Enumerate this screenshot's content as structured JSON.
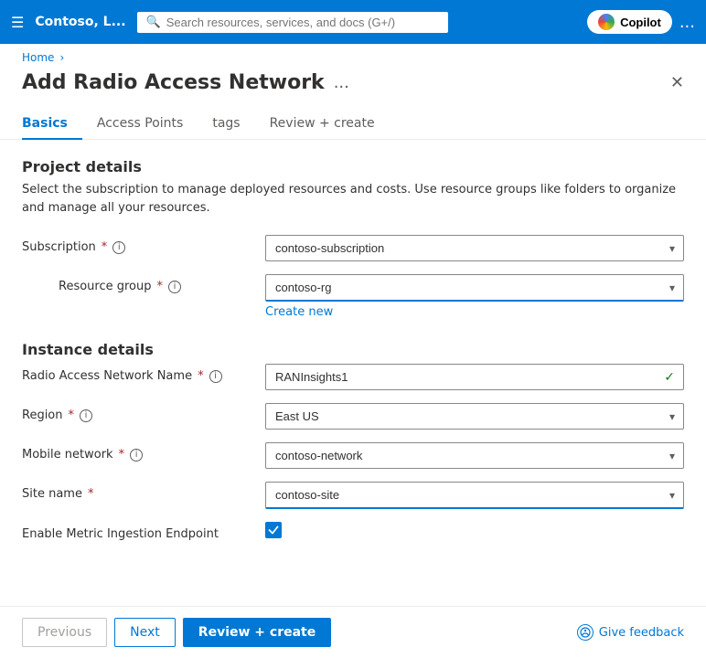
{
  "topnav": {
    "hamburger": "☰",
    "title": "Contoso, L...",
    "search_placeholder": "Search resources, services, and docs (G+/)",
    "copilot_label": "Copilot",
    "ellipsis": "..."
  },
  "breadcrumb": {
    "home": "Home",
    "separator": "›"
  },
  "page": {
    "title": "Add Radio Access Network",
    "ellipsis": "...",
    "close_label": "✕"
  },
  "tabs": [
    {
      "id": "basics",
      "label": "Basics",
      "active": true
    },
    {
      "id": "access-points",
      "label": "Access Points",
      "active": false
    },
    {
      "id": "tags",
      "label": "tags",
      "active": false
    },
    {
      "id": "review-create",
      "label": "Review + create",
      "active": false
    }
  ],
  "project_details": {
    "section_title": "Project details",
    "section_desc": "Select the subscription to manage deployed resources and costs. Use resource groups like folders to organize and manage all your resources.",
    "subscription_label": "Subscription",
    "subscription_value": "contoso-subscription",
    "resource_group_label": "Resource group",
    "resource_group_value": "contoso-rg",
    "create_new_label": "Create new"
  },
  "instance_details": {
    "section_title": "Instance details",
    "ran_name_label": "Radio Access Network Name",
    "ran_name_value": "RANInsights1",
    "region_label": "Region",
    "region_value": "East US",
    "mobile_network_label": "Mobile network",
    "mobile_network_value": "contoso-network",
    "site_name_label": "Site name",
    "site_name_value": "contoso-site",
    "metric_label": "Enable Metric Ingestion Endpoint",
    "metric_checked": true
  },
  "footer": {
    "previous_label": "Previous",
    "next_label": "Next",
    "review_create_label": "Review + create",
    "feedback_label": "Give feedback"
  }
}
